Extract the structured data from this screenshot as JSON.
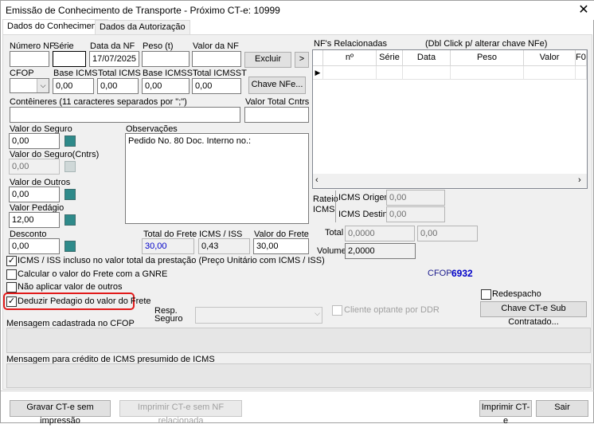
{
  "window": {
    "title": "Emissão de Conhecimento de Transporte - Próximo CT-e: 10999",
    "close_glyph": "✕"
  },
  "tabs": [
    "Dados do Conhecimento",
    "Dados da Autorização"
  ],
  "nf": {
    "labels": {
      "numero": "Número NF",
      "serie": "Série",
      "data": "Data da NF",
      "peso": "Peso (t)",
      "valor": "Valor da NF"
    },
    "values": {
      "numero": "",
      "serie": "",
      "data": "17/07/2025",
      "peso": "",
      "valor": ""
    },
    "excluir_label": "Excluir",
    "arrow_label": ">"
  },
  "icms": {
    "labels": {
      "cfop": "CFOP",
      "base_icms": "Base ICMS",
      "total_icms": "Total ICMS",
      "base_icmsst": "Base ICMSST",
      "total_icmsst": "Total ICMSST"
    },
    "values": {
      "cfop": "",
      "base_icms": "0,00",
      "total_icms": "0,00",
      "base_icmsst": "0,00",
      "total_icmsst": "0,00"
    },
    "chave_nfe_label": "Chave NFe..."
  },
  "containers": {
    "label": "Contêineres (11 caracteres separados por \";\")",
    "value": "",
    "total_label": "Valor Total Cntrs",
    "total_value": ""
  },
  "valores": {
    "seguro": {
      "label": "Valor do Seguro",
      "value": "0,00"
    },
    "seguro_cntrs": {
      "label": "Valor do Seguro(Cntrs)",
      "value": "0,00"
    },
    "outros": {
      "label": "Valor de Outros",
      "value": "0,00"
    },
    "pedagio": {
      "label": "Valor Pedágio",
      "value": "12,00"
    },
    "desconto": {
      "label": "Desconto",
      "value": "0,00"
    }
  },
  "observacoes": {
    "label": "Observações",
    "value": "Pedido No. 80 Doc. Interno no.:"
  },
  "totais": {
    "total_frete": {
      "label": "Total do Frete",
      "value": "30,00"
    },
    "icms_iss": {
      "label": "ICMS / ISS",
      "value": "0,43"
    },
    "valor_frete": {
      "label": "Valor do Frete",
      "value": "30,00"
    }
  },
  "checkboxes": [
    {
      "label": "ICMS / ISS incluso no valor total da prestação (Preço Unitário com ICMS / ISS)",
      "checked": true
    },
    {
      "label": "Calcular o valor do Frete com a GNRE",
      "checked": false
    },
    {
      "label": "Não aplicar valor de outros",
      "checked": false
    },
    {
      "label": "Deduzir Pedagio do valor do Frete",
      "checked": true
    }
  ],
  "nfs_relacionadas": {
    "label": "NF's Relacionadas",
    "hint": "(Dbl Click p/ alterar chave NFe)",
    "columns": [
      "nº",
      "Série",
      "Data",
      "Peso",
      "Valor",
      "F0"
    ],
    "row_pointer": "▶"
  },
  "rateio": {
    "label_line1": "Rateio",
    "label_line2": "ICMS",
    "origem": {
      "label": "ICMS Origem",
      "value": "0,00"
    },
    "destino": {
      "label": "ICMS Destino",
      "value": "0,00"
    },
    "total": {
      "label": "Total",
      "value1": "0,0000",
      "value2": "0,00"
    },
    "volume": {
      "label": "Volume",
      "value": "2,0000"
    }
  },
  "cfop_display": {
    "label": "CFOP:",
    "value": "6932"
  },
  "redespacho": {
    "label": "Redespacho",
    "checked": false
  },
  "chave_subcontratado_label": "Chave CT-e Sub Contratado...",
  "resp_seguro": {
    "label_line1": "Resp.",
    "label_line2": "Seguro",
    "value": ""
  },
  "cliente_ddr": {
    "label": "Cliente optante por DDR",
    "checked": false
  },
  "mensagens": {
    "cfop_label": "Mensagem cadastrada no CFOP",
    "icms_label": "Mensagem para crédito de ICMS presumido de ICMS"
  },
  "footer": {
    "gravar_label": "Gravar CT-e sem impressão",
    "imprimir_sem_nf_label": "Imprimir CT-e sem NF relacionada",
    "imprimir_label": "Imprimir CT-e",
    "sair_label": "Sair"
  },
  "colors": {
    "highlight": "#e11b1b",
    "cfop_value": "#0000c8",
    "blue_value": "#0000c8"
  }
}
